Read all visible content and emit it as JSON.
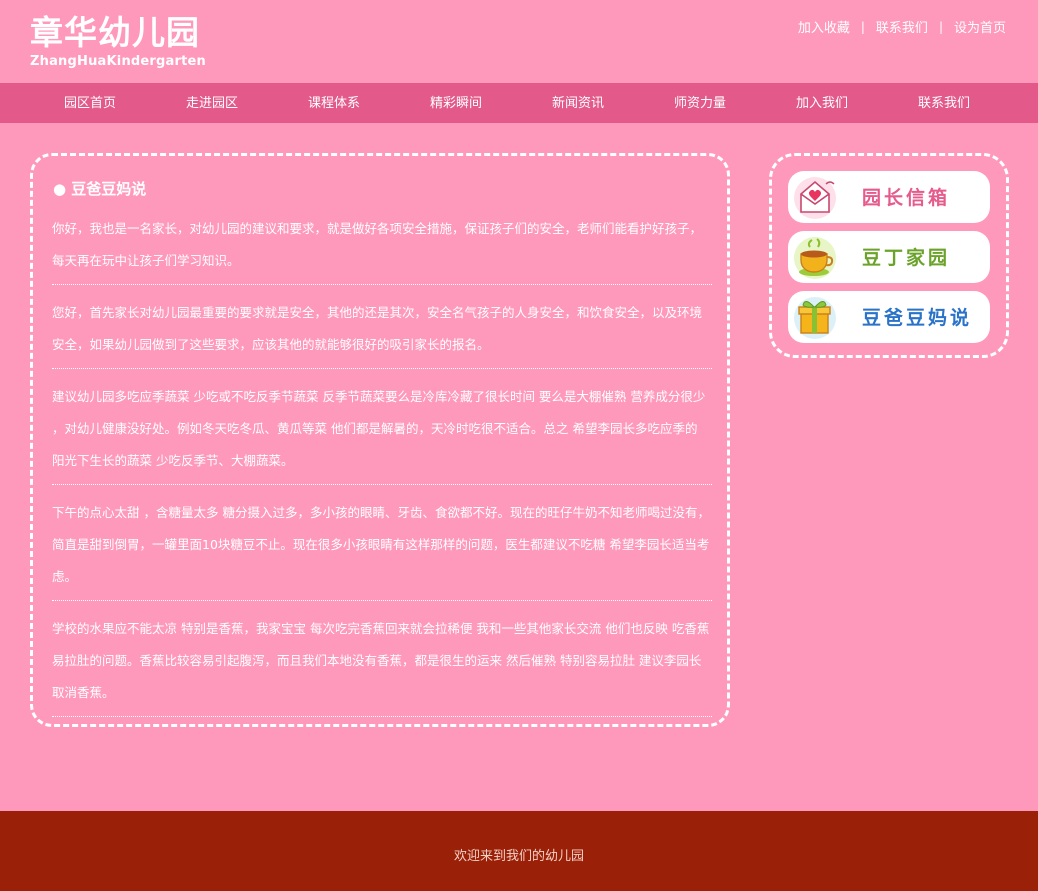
{
  "logo": {
    "title_cn": "章华幼儿园",
    "title_en": "ZhangHuaKindergarten"
  },
  "top_links": {
    "favorite": "加入收藏",
    "contact": "联系我们",
    "homepage": "设为首页",
    "separator": "|"
  },
  "nav": {
    "items": [
      "园区首页",
      "走进园区",
      "课程体系",
      "精彩瞬间",
      "新闻资讯",
      "师资力量",
      "加入我们",
      "联系我们"
    ]
  },
  "main": {
    "section_title": "● 豆爸豆妈说",
    "paragraphs": [
      "你好，我也是一名家长，对幼儿园的建议和要求，就是做好各项安全措施，保证孩子们的安全，老师们能看护好孩子，每天再在玩中让孩子们学习知识。",
      "您好，首先家长对幼儿园最重要的要求就是安全，其他的还是其次，安全名气孩子的人身安全，和饮食安全，以及环境安全，如果幼儿园做到了这些要求，应该其他的就能够很好的吸引家长的报名。",
      "建议幼儿园多吃应季蔬菜 少吃或不吃反季节蔬菜 反季节蔬菜要么是冷库冷藏了很长时间 要么是大棚催熟 营养成分很少 ，对幼儿健康没好处。例如冬天吃冬瓜、黄瓜等菜 他们都是解暑的，天冷时吃很不适合。总之 希望李园长多吃应季的 阳光下生长的蔬菜 少吃反季节、大棚蔬菜。",
      "下午的点心太甜 ，含糖量太多 糖分摄入过多，多小孩的眼睛、牙齿、食欲都不好。现在的旺仔牛奶不知老师喝过没有，简直是甜到倒胃，一罐里面10块糖豆不止。现在很多小孩眼睛有这样那样的问题，医生都建议不吃糖 希望李园长适当考虑。",
      "学校的水果应不能太凉 特别是香蕉，我家宝宝 每次吃完香蕉回来就会拉稀便 我和一些其他家长交流 他们也反映 吃香蕉易拉肚的问题。香蕉比较容易引起腹泻，而且我们本地没有香蕉，都是很生的运来 然后催熟 特别容易拉肚 建议李园长取消香蕉。"
    ]
  },
  "sidebar": {
    "buttons": [
      {
        "label": "园长信箱",
        "icon": "envelope-heart-icon",
        "color": "#e55b8c"
      },
      {
        "label": "豆丁家园",
        "icon": "teacup-icon",
        "color": "#6ba32a"
      },
      {
        "label": "豆爸豆妈说",
        "icon": "gift-box-icon",
        "color": "#2a73c8"
      }
    ]
  },
  "footer": {
    "text": "欢迎来到我们的幼儿园"
  },
  "colors": {
    "page_bg": "#ff99bb",
    "nav_bg": "#e3598a",
    "footer_bg": "#9b2008"
  }
}
